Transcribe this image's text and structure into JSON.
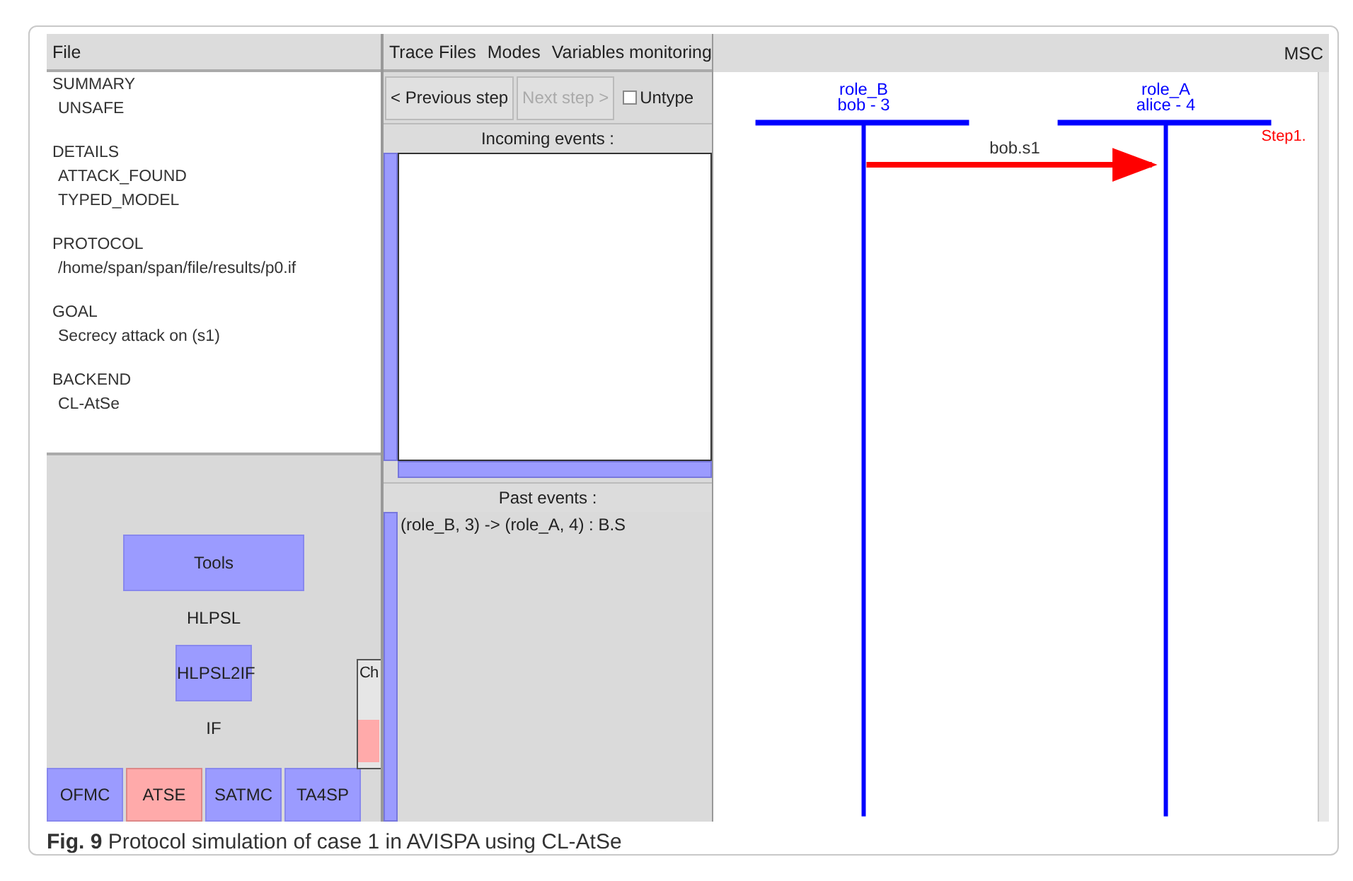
{
  "left_panel": {
    "menu": [
      "File"
    ],
    "results": [
      {
        "heading": "SUMMARY",
        "lines": [
          "UNSAFE"
        ]
      },
      {
        "heading": "DETAILS",
        "lines": [
          "ATTACK_FOUND",
          "TYPED_MODEL"
        ]
      },
      {
        "heading": "PROTOCOL",
        "lines": [
          "/home/span/span/file/results/p0.if"
        ]
      },
      {
        "heading": "GOAL",
        "lines": [
          "Secrecy attack on (s1)"
        ]
      },
      {
        "heading": "BACKEND",
        "lines": [
          "CL-AtSe"
        ]
      }
    ],
    "tools_button": "Tools",
    "hlpsl_label": "HLPSL",
    "translate_button": "HLPSL2IF",
    "if_label": "IF",
    "side_box_label": "Ch",
    "backends": [
      {
        "label": "OFMC",
        "selected": false
      },
      {
        "label": "ATSE",
        "selected": true
      },
      {
        "label": "SATMC",
        "selected": false
      },
      {
        "label": "TA4SP",
        "selected": false
      }
    ]
  },
  "middle_panel": {
    "menu": [
      "Trace Files",
      "Modes",
      "Variables monitoring"
    ],
    "buttons": [
      {
        "label": "< Previous step",
        "disabled": false
      },
      {
        "label": "Next step >",
        "disabled": true
      }
    ],
    "untype": {
      "label": "Untype",
      "checked": false
    },
    "incoming_header": "Incoming events :",
    "past_header": "Past events :",
    "past_events": [
      "(role_B, 3) -> (role_A, 4) : B.S"
    ]
  },
  "msc_panel": {
    "title": "MSC",
    "roles": [
      {
        "name": "role_B",
        "instance": "bob - 3"
      },
      {
        "name": "role_A",
        "instance": "alice - 4"
      }
    ],
    "messages": [
      {
        "label": "bob.s1"
      }
    ],
    "step_label": "Step1."
  },
  "caption": "**Fig. 9** Protocol simulation of case 1 in AVISPA using CL-AtSe"
}
